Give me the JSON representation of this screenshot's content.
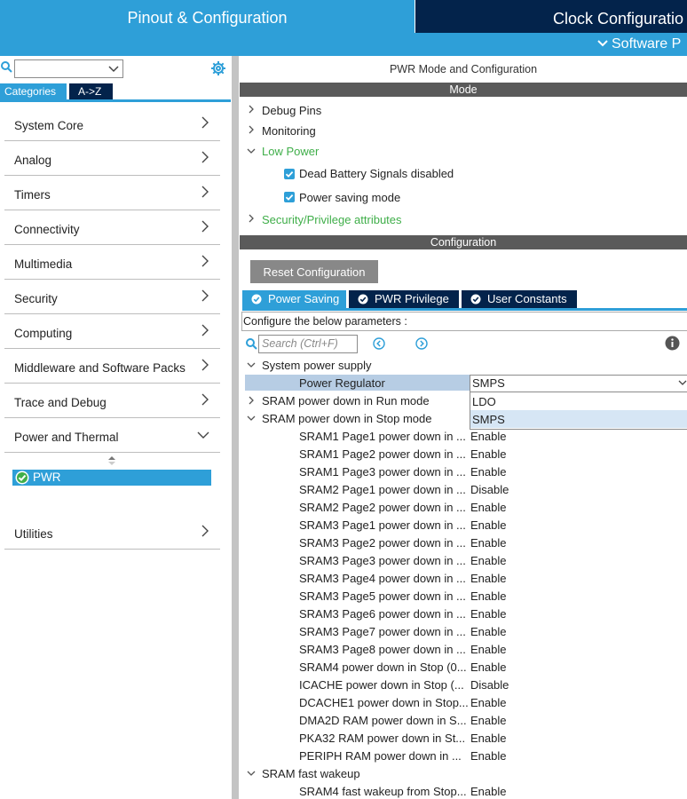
{
  "header": {
    "left_tab": "Pinout & Configuration",
    "right_tab": "Clock Configuratio",
    "software_packs": "Software P"
  },
  "left_panel": {
    "search": {
      "value": ""
    },
    "tabs": {
      "categories": "Categories",
      "atoz": "A->Z"
    },
    "categories": [
      "System Core",
      "Analog",
      "Timers",
      "Connectivity",
      "Multimedia",
      "Security",
      "Computing",
      "Middleware and Software Packs",
      "Trace and Debug",
      "Power and Thermal"
    ],
    "selected_item": "PWR",
    "utilities": "Utilities"
  },
  "mode": {
    "title": "PWR Mode and Configuration",
    "bar": "Mode",
    "tree": {
      "debug_pins": "Debug Pins",
      "monitoring": "Monitoring",
      "low_power": "Low Power",
      "dead_battery": "Dead Battery Signals disabled",
      "power_saving": "Power saving mode",
      "security": "Security/Privilege attributes"
    }
  },
  "configuration": {
    "bar": "Configuration",
    "reset_button": "Reset Configuration",
    "tabs": [
      "Power Saving",
      "PWR Privilege",
      "User Constants"
    ],
    "configure_text": "Configure the below parameters :",
    "search_placeholder": "Search (Ctrl+F)",
    "groups": {
      "system_power_supply": "System power supply",
      "power_regulator_label": "Power Regulator",
      "power_regulator_value": "SMPS",
      "regulator_options": [
        "LDO",
        "SMPS"
      ],
      "run_mode": "SRAM power down in Run mode",
      "stop_mode": "SRAM power down in Stop mode",
      "fast_wakeup": "SRAM fast wakeup"
    },
    "stop_mode_params": [
      {
        "name": "SRAM1 Page1 power down in ...",
        "value": "Enable"
      },
      {
        "name": "SRAM1 Page2 power down in ...",
        "value": "Enable"
      },
      {
        "name": "SRAM1 Page3 power down in ...",
        "value": "Enable"
      },
      {
        "name": "SRAM2 Page1 power down in ...",
        "value": "Disable"
      },
      {
        "name": "SRAM2 Page2 power down in ...",
        "value": "Enable"
      },
      {
        "name": "SRAM3 Page1 power down in ...",
        "value": "Enable"
      },
      {
        "name": "SRAM3 Page2 power down in ...",
        "value": "Enable"
      },
      {
        "name": "SRAM3 Page3 power down in ...",
        "value": "Enable"
      },
      {
        "name": "SRAM3 Page4 power down in ...",
        "value": "Enable"
      },
      {
        "name": "SRAM3 Page5 power down in ...",
        "value": "Enable"
      },
      {
        "name": "SRAM3 Page6 power down in ...",
        "value": "Enable"
      },
      {
        "name": "SRAM3 Page7 power down in ...",
        "value": "Enable"
      },
      {
        "name": "SRAM3 Page8 power down in ...",
        "value": "Enable"
      },
      {
        "name": "SRAM4 power down in Stop (0...",
        "value": "Enable"
      },
      {
        "name": "ICACHE power down in Stop (...",
        "value": "Disable"
      },
      {
        "name": "DCACHE1 power down in Stop...",
        "value": "Enable"
      },
      {
        "name": "DMA2D RAM power down in S...",
        "value": "Enable"
      },
      {
        "name": "PKA32 RAM power down in St...",
        "value": "Enable"
      },
      {
        "name": "PERIPH RAM power down in ...",
        "value": "Enable"
      }
    ],
    "fast_wakeup_params": [
      {
        "name": "SRAM4 fast wakeup from Stop...",
        "value": "Enable"
      }
    ]
  }
}
